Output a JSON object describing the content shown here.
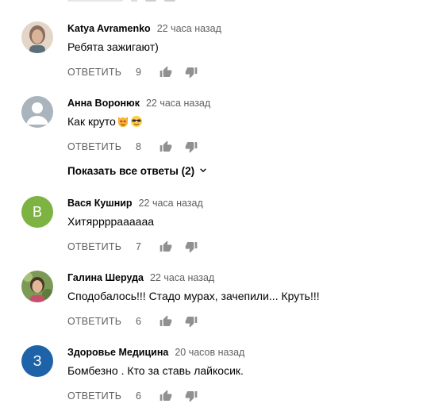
{
  "labels": {
    "reply": "ОТВЕТИТЬ"
  },
  "colors": {
    "link": "#030303",
    "secondary": "#606060",
    "icon": "#909090"
  },
  "comments": [
    {
      "author": "Katya Avramenko",
      "time": "22 часа назад",
      "text": "Ребята зажигают)",
      "likes": "9",
      "avatar": {
        "type": "photo",
        "colors": [
          "#c9a98a",
          "#8a6f5c"
        ]
      }
    },
    {
      "author": "Анна Воронюк",
      "time": "22 часа назад",
      "text": "Как круто",
      "emoji": [
        "cat-heart-eyes-emoji",
        "sunglasses-emoji"
      ],
      "likes": "8",
      "avatar": {
        "type": "default",
        "colors": [
          "#a9b4bd",
          "#ffffff"
        ]
      },
      "show_replies": "Показать все ответы (2)"
    },
    {
      "author": "Вася Кушнир",
      "time": "22 часа назад",
      "text": "Хитяррррааааaa",
      "likes": "7",
      "avatar": {
        "type": "letter",
        "letter": "В",
        "colors": [
          "#7cb342"
        ]
      }
    },
    {
      "author": "Галина Шеруда",
      "time": "22 часа назад",
      "text": "Сподобалось!!! Стадо мурах, зачепили... Круть!!!",
      "likes": "6",
      "avatar": {
        "type": "photo",
        "colors": [
          "#6a8f4a",
          "#d9b08c"
        ]
      }
    },
    {
      "author": "Здоровье Медицина",
      "time": "20 часов назад",
      "text": "Бомбезно . Кто за ставь лайкосик.",
      "likes": "6",
      "avatar": {
        "type": "letter",
        "letter": "З",
        "colors": [
          "#1e63a8"
        ]
      }
    }
  ]
}
